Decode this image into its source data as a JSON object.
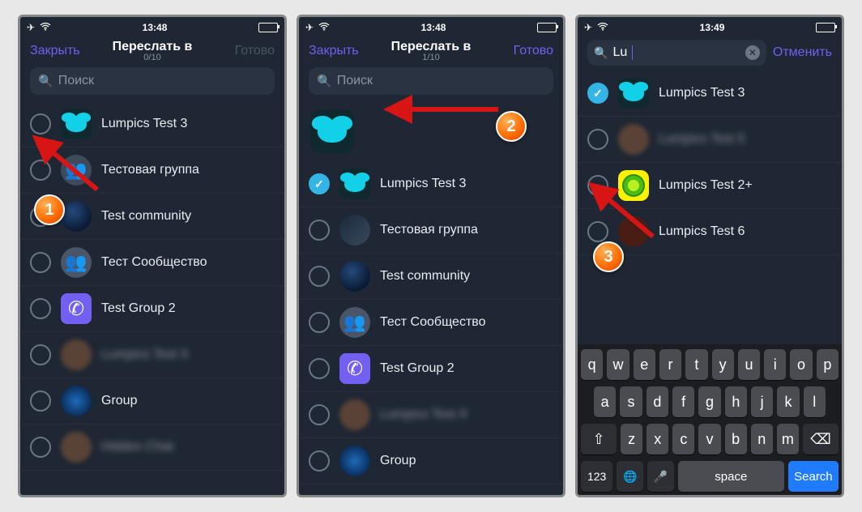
{
  "status": {
    "time1": "13:48",
    "time2": "13:48",
    "time3": "13:49"
  },
  "nav": {
    "close": "Закрыть",
    "title": "Переслать в",
    "count0": "0/10",
    "count1": "1/10",
    "done": "Готово",
    "cancel": "Отменить"
  },
  "search": {
    "placeholder": "Поиск",
    "typed": "Lu"
  },
  "chats": {
    "lumpics3": "Lumpics Test 3",
    "testgroup": "Тестовая группа",
    "testcommunity": "Test community",
    "testcomm_ru": "Тест Сообщество",
    "testgroup2": "Test Group 2",
    "blurred1": "Lumpics Test X",
    "group": "Group",
    "blurred2": "Hidden Chat",
    "lumpics2": "Lumpics Test 2+",
    "lumpics6": "Lumpics Test 6",
    "hidden3": "Lumpics Test 5"
  },
  "keyboard": {
    "r1": [
      "q",
      "w",
      "e",
      "r",
      "t",
      "y",
      "u",
      "i",
      "o",
      "p"
    ],
    "r2": [
      "a",
      "s",
      "d",
      "f",
      "g",
      "h",
      "j",
      "k",
      "l"
    ],
    "r3": [
      "z",
      "x",
      "c",
      "v",
      "b",
      "n",
      "m"
    ],
    "num": "123",
    "globe": "🌐",
    "mic": "🎤",
    "space": "space",
    "search": "Search"
  },
  "markers": {
    "m1": "1",
    "m2": "2",
    "m3": "3"
  }
}
